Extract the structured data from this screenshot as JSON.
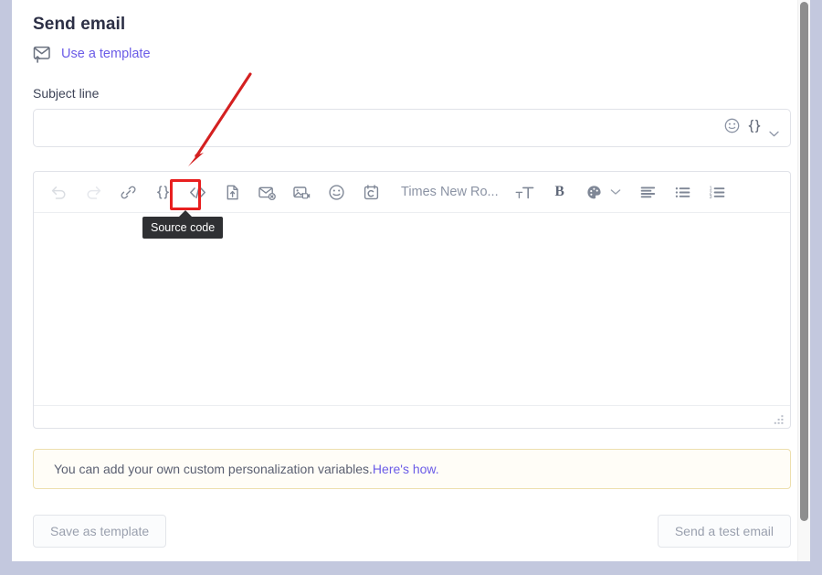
{
  "window": {
    "bg_color": "#c3c8de",
    "panel_color": "#ffffff"
  },
  "header": {
    "title": "Send email",
    "template_link": "Use a template",
    "template_icon": "envelope-upload-icon",
    "link_color": "#6b5ce7"
  },
  "subject": {
    "label": "Subject line",
    "value": "",
    "placeholder": "",
    "emoji_icon": "emoji-smiley-icon",
    "variables_icon": "curly-braces-icon",
    "chevron_icon": "chevron-down-icon"
  },
  "toolbar": {
    "buttons": [
      {
        "name": "undo-button",
        "label": "Undo",
        "icon": "undo-icon",
        "disabled": true
      },
      {
        "name": "redo-button",
        "label": "Redo",
        "icon": "redo-icon",
        "disabled": true
      },
      {
        "name": "insert-link-button",
        "label": "Insert link",
        "icon": "link-icon",
        "disabled": false
      },
      {
        "name": "personalization-button",
        "label": "Personalization",
        "icon": "curly-braces-icon",
        "disabled": false
      },
      {
        "name": "source-code-button",
        "label": "Source code",
        "icon": "code-brackets-icon",
        "disabled": false
      },
      {
        "name": "insert-file-button",
        "label": "Insert file",
        "icon": "file-upload-icon",
        "disabled": false
      },
      {
        "name": "unsubscribe-link-button",
        "label": "Unsubscribe link",
        "icon": "envelope-remove-icon",
        "disabled": false
      },
      {
        "name": "insert-video-button",
        "label": "Insert video",
        "icon": "image-video-icon",
        "disabled": false
      },
      {
        "name": "emoji-button",
        "label": "Emoji",
        "icon": "emoji-smiley-icon",
        "disabled": false
      },
      {
        "name": "calendar-button",
        "label": "Calendar",
        "icon": "calendar-c-icon",
        "disabled": false
      }
    ],
    "font_name": "Times New Ro...",
    "font_size_icon": "font-size-icon",
    "bold_label": "B",
    "color_icon": "color-palette-icon",
    "color_chevron_icon": "chevron-down-icon",
    "align_icon": "align-left-icon",
    "bullet_list_icon": "bullet-list-icon",
    "numbered_list_icon": "numbered-list-icon"
  },
  "tooltip": {
    "text": "Source code"
  },
  "annotation": {
    "highlight_color": "#e81f1f",
    "arrow_color": "#d42020"
  },
  "editor": {
    "body_text": "",
    "resize_grip_icon": "resize-grip-icon"
  },
  "notice": {
    "text": "You can add your own custom personalization variables. ",
    "link_text": "Here's how.",
    "border_color": "#eddfae"
  },
  "footer": {
    "save_template_label": "Save as template",
    "send_test_label": "Send a test email"
  },
  "scrollbar": {
    "thumb_color": "#8e8e8e"
  }
}
